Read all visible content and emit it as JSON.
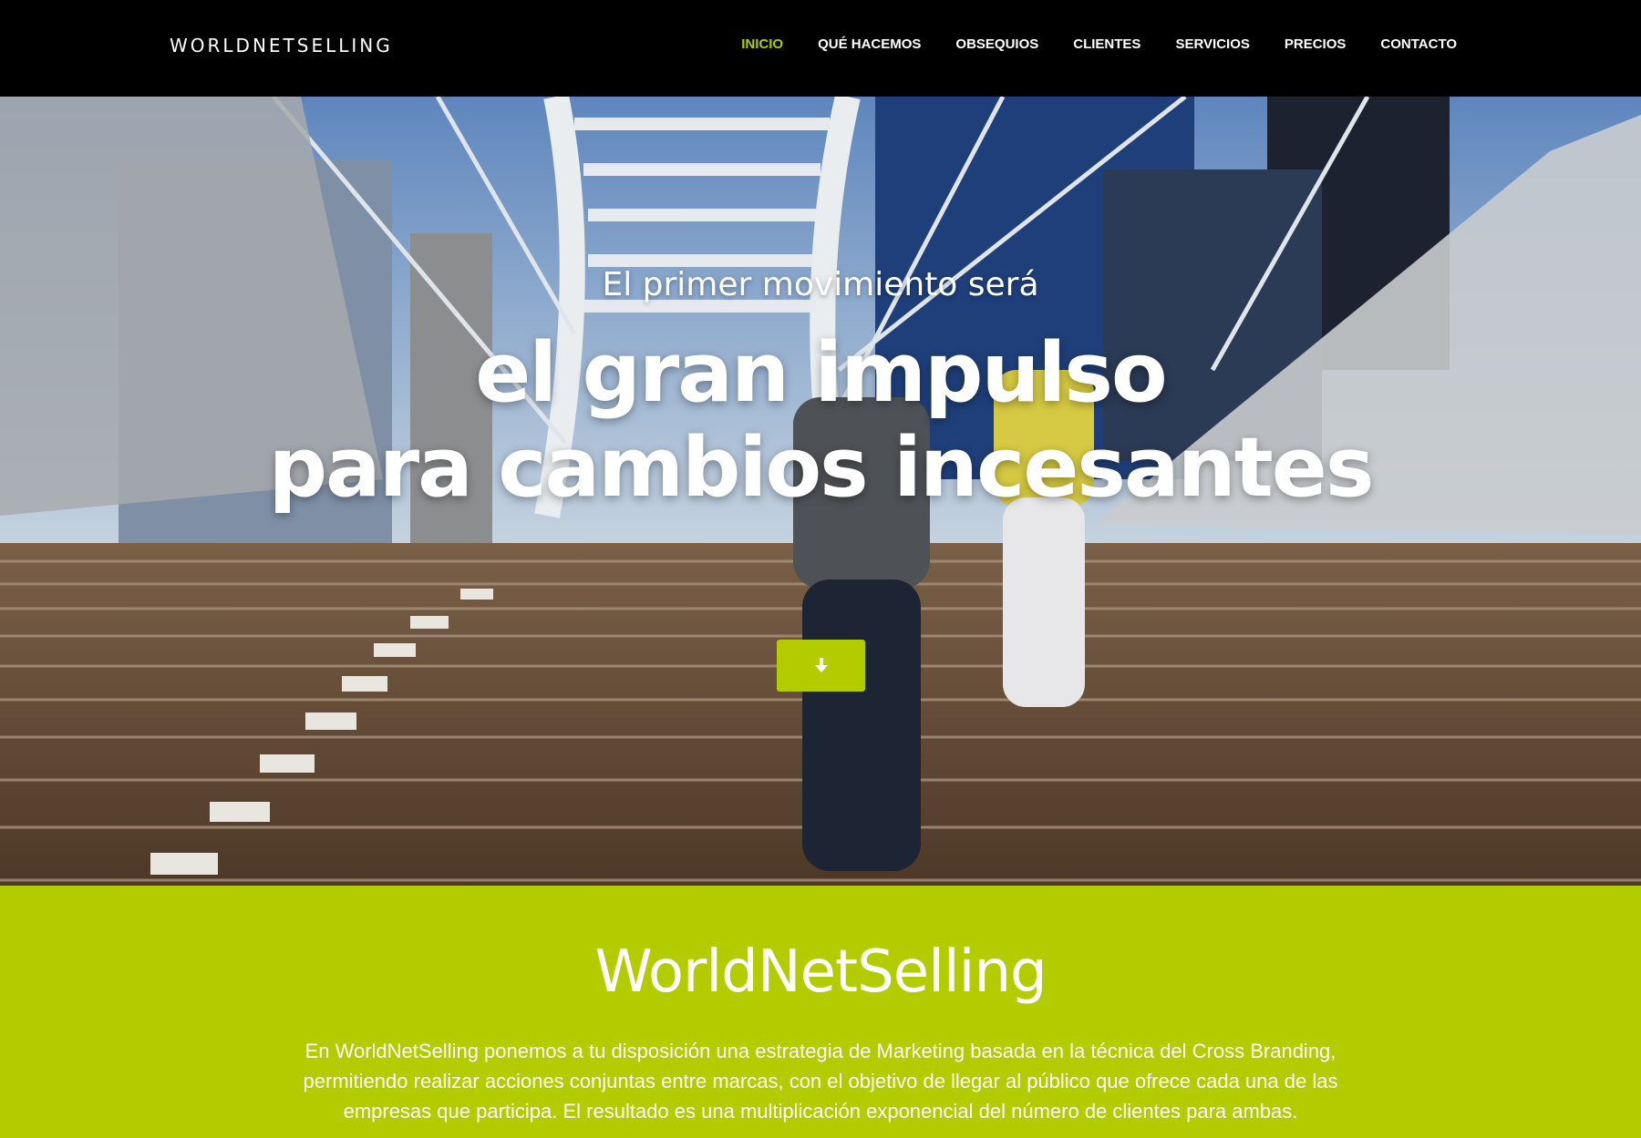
{
  "header": {
    "brand": "WORLDNETSELLING",
    "nav": [
      {
        "label": "INICIO",
        "active": true
      },
      {
        "label": "QUÉ HACEMOS",
        "active": false
      },
      {
        "label": "OBSEQUIOS",
        "active": false
      },
      {
        "label": "CLIENTES",
        "active": false
      },
      {
        "label": "SERVICIOS",
        "active": false
      },
      {
        "label": "PRECIOS",
        "active": false
      },
      {
        "label": "CONTACTO",
        "active": false
      }
    ]
  },
  "hero": {
    "subtitle": "El primer movimiento será",
    "title_line1": "el gran impulso",
    "title_line2": "para cambios incesantes",
    "scroll_icon": "arrow-down-icon"
  },
  "intro": {
    "heading": "WorldNetSelling",
    "text": "En WorldNetSelling ponemos a tu disposición una estrategia de Marketing basada en la técnica del Cross Branding, permitiendo realizar acciones conjuntas entre marcas, con el objetivo de llegar al público que ofrece cada una de las empresas que participa. El resultado es una multiplicación exponencial del número de clientes para ambas."
  },
  "colors": {
    "accent": "#b3cc00",
    "header_bg": "#000000",
    "text_light": "#ffffff"
  }
}
